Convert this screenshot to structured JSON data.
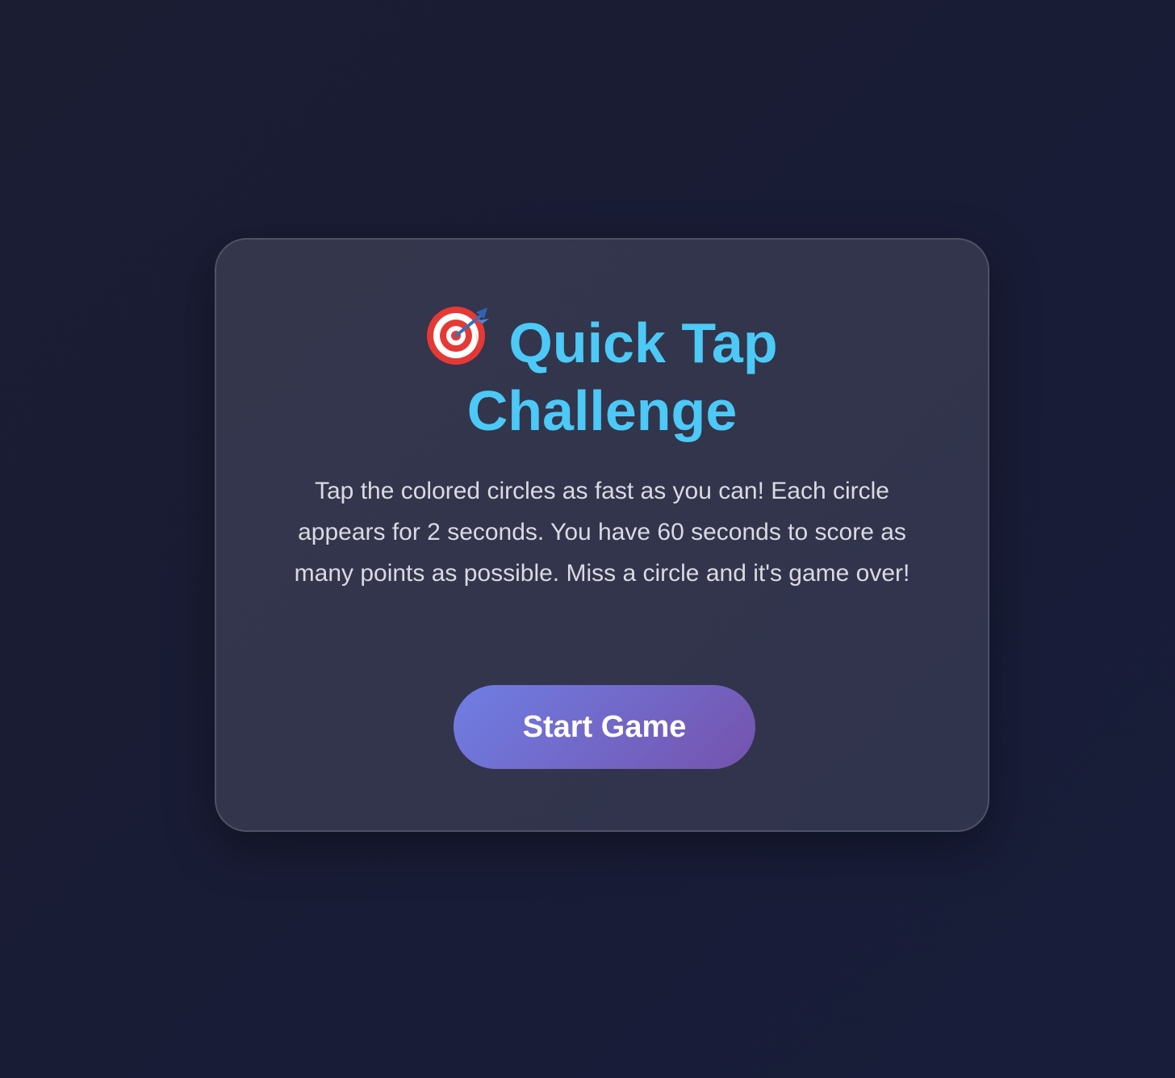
{
  "game": {
    "title_line1": "Quick Tap",
    "title_line2": "Challenge",
    "icon": "target-dart-icon",
    "description": "Tap the colored circles as fast as you can! Each circle appears for 2 seconds. You have 60 seconds to score as many points as possible. Miss a circle and it's game over!",
    "start_button_label": "Start Game"
  },
  "colors": {
    "background": "#1a1d36",
    "card": "#32354b",
    "title": "#4cc9f6",
    "text": "#d9dae3",
    "button_start": "#6f7ee4",
    "button_end": "#7553ad"
  }
}
